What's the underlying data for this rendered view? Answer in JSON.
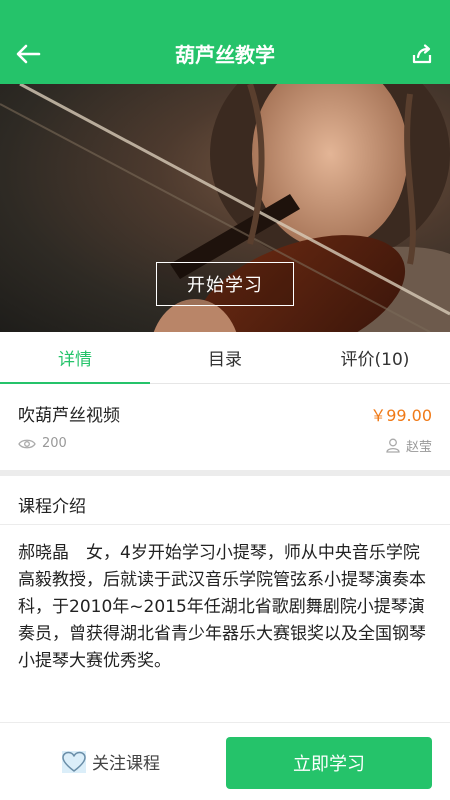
{
  "header": {
    "title": "葫芦丝教学",
    "back_icon": "arrow-left-icon",
    "share_icon": "share-icon",
    "background_color": "#25c36a"
  },
  "hero": {
    "start_label": "开始学习"
  },
  "tabs": [
    {
      "label": "详情",
      "active": true
    },
    {
      "label": "目录",
      "active": false
    },
    {
      "label": "评价(10)",
      "active": false
    }
  ],
  "course": {
    "name": "吹葫芦丝视频",
    "price": "￥99.00",
    "views": "200",
    "author": "赵莹",
    "price_color": "#f07a18"
  },
  "intro": {
    "heading": "课程介绍",
    "text": "郝晓晶　女，4岁开始学习小提琴，师从中央音乐学院高毅教授，后就读于武汉音乐学院管弦系小提琴演奏本科，于2010年~2015年任湖北省歌剧舞剧院小提琴演奏员，曾获得湖北省青少年器乐大赛银奖以及全国钢琴小提琴大赛优秀奖。"
  },
  "bottom": {
    "follow_label": "关注课程",
    "learn_label": "立即学习"
  }
}
